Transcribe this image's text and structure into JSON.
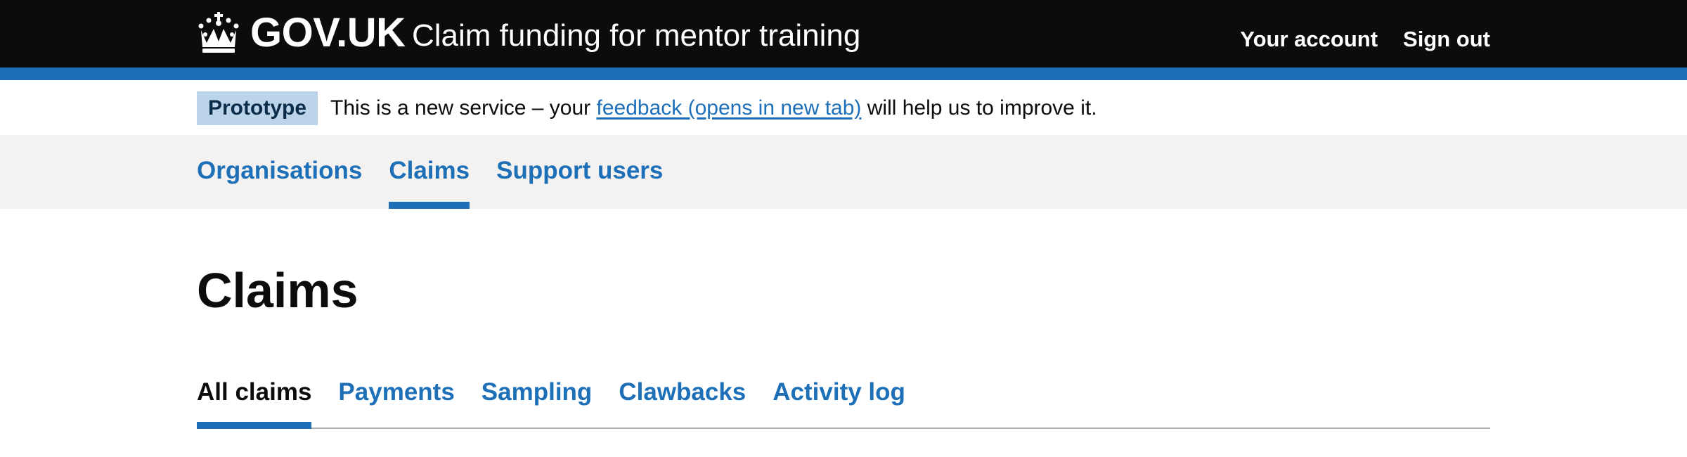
{
  "header": {
    "logo_text": "GOV.UK",
    "logo_icon": "crown-icon",
    "service_name": "Claim funding for mentor training",
    "nav": [
      {
        "label": "Your account"
      },
      {
        "label": "Sign out"
      }
    ],
    "background_color": "#0b0c0c",
    "accent_color": "#1d70b8"
  },
  "phase_banner": {
    "tag": "Prototype",
    "text_before": "This is a new service – your ",
    "link_text": "feedback (opens in new tab)",
    "text_after": " will help us to improve it."
  },
  "primary_nav": {
    "items": [
      {
        "label": "Organisations",
        "active": false
      },
      {
        "label": "Claims",
        "active": true
      },
      {
        "label": "Support users",
        "active": false
      }
    ]
  },
  "page": {
    "title": "Claims"
  },
  "sub_nav": {
    "items": [
      {
        "label": "All claims",
        "active": true
      },
      {
        "label": "Payments",
        "active": false
      },
      {
        "label": "Sampling",
        "active": false
      },
      {
        "label": "Clawbacks",
        "active": false
      },
      {
        "label": "Activity log",
        "active": false
      }
    ]
  }
}
